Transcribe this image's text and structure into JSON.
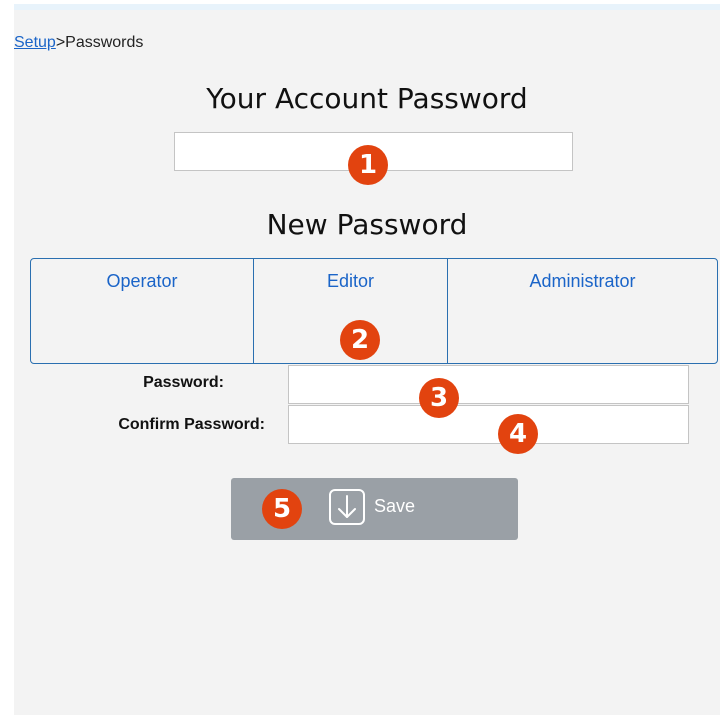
{
  "breadcrumb": {
    "link": "Setup",
    "separator": ">",
    "current": "Passwords"
  },
  "account": {
    "heading": "Your Account Password",
    "value": ""
  },
  "new_password": {
    "heading": "New Password"
  },
  "roles": [
    {
      "label": "Operator"
    },
    {
      "label": "Editor"
    },
    {
      "label": "Administrator"
    }
  ],
  "form": {
    "password_label": "Password:",
    "password_value": "",
    "confirm_label": "Confirm Password:",
    "confirm_value": ""
  },
  "save": {
    "label": "Save",
    "icon": "save-download-icon"
  },
  "badges": [
    "1",
    "2",
    "3",
    "4",
    "5"
  ],
  "colors": {
    "link": "#1a64c8",
    "role_border": "#2a6fb0",
    "button_bg": "#9aa0a6",
    "badge": "#e2430f",
    "panel_bg": "#f3f3f3"
  }
}
